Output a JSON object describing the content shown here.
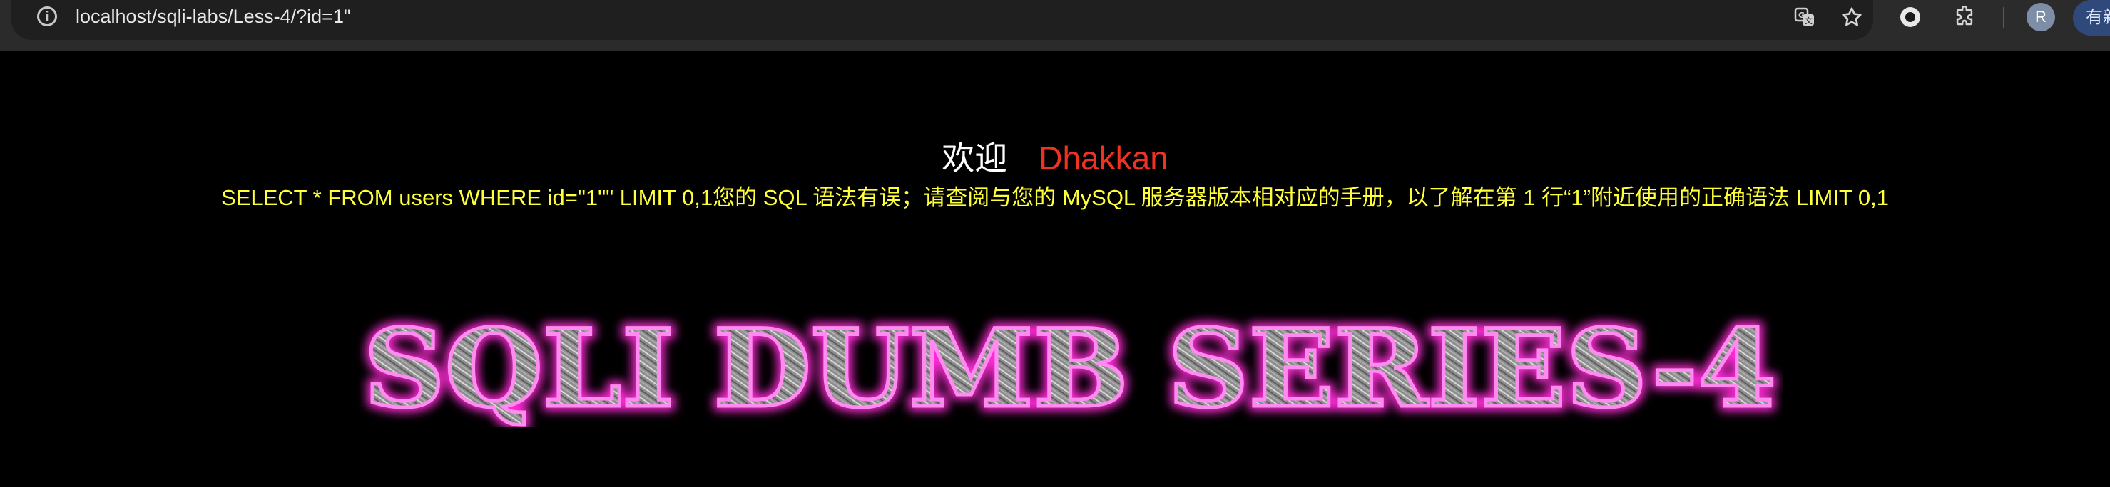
{
  "browser": {
    "url": "localhost/sqli-labs/Less-4/?id=1\"",
    "info_icon": "info-icon",
    "actions": [
      "translate-icon",
      "star-icon",
      "extension-circle-icon",
      "puzzle-icon"
    ],
    "avatar_letter": "R",
    "update_label": "有新"
  },
  "page": {
    "welcome_label": "欢迎",
    "welcome_name": "Dhakkan",
    "sql_message": "SELECT * FROM users WHERE id=\"1\"\" LIMIT 0,1您的 SQL 语法有误；请查阅与您的 MySQL 服务器版本相对应的手册，以了解在第 1 行“1”附近使用的正确语法 LIMIT 0,1",
    "banner_text": "SQLI DUMB SERIES-4"
  },
  "colors": {
    "background": "#000000",
    "welcome_label": "#ffffff",
    "welcome_name": "#ee3322",
    "sql_message": "#ffff3a",
    "banner_glow": "#ff2bd6",
    "banner_fill": "#9a9a9a"
  }
}
